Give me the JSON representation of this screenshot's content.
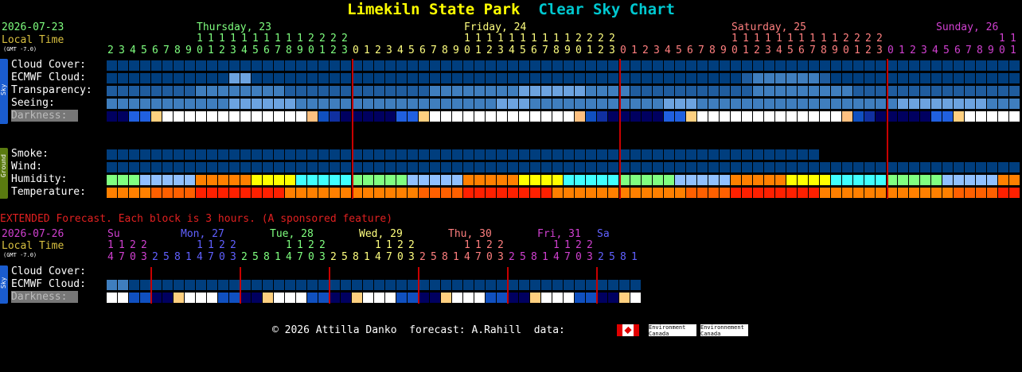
{
  "header": {
    "site_name": "Limekiln State Park",
    "chart_name": "Clear Sky Chart",
    "site_color": "#ffff00",
    "chart_color": "#00c8d0"
  },
  "main": {
    "date": "2026-07-23",
    "local_time_label": "Local Time",
    "gmt_offset": "(GMT -7.0)",
    "days": [
      {
        "label": "Thursday, 23",
        "color": "#7fff7f"
      },
      {
        "label": "Friday, 24",
        "color": "#ffff7f"
      },
      {
        "label": "Saturday, 25",
        "color": "#ff7f7f"
      },
      {
        "label": "Sunday, 26",
        "color": "#d040d0"
      }
    ],
    "hours_tens": [
      "",
      "",
      "",
      "",
      "",
      "",
      "",
      "",
      "1",
      "1",
      "1",
      "1",
      "1",
      "1",
      "1",
      "1",
      "1",
      "1",
      "2",
      "2",
      "2",
      "2",
      "",
      "",
      "",
      "",
      "",
      "",
      "",
      "",
      "",
      "",
      "1",
      "1",
      "1",
      "1",
      "1",
      "1",
      "1",
      "1",
      "1",
      "1",
      "2",
      "2",
      "2",
      "2",
      "",
      "",
      "",
      "",
      "",
      "",
      "",
      "",
      "",
      "",
      "1",
      "1",
      "1",
      "1",
      "1",
      "1",
      "1",
      "1",
      "1",
      "1",
      "2",
      "2",
      "2",
      "2",
      "",
      "",
      "",
      "",
      "",
      "",
      "",
      "",
      "",
      "",
      "1",
      "1"
    ],
    "hours_ones": [
      "2",
      "3",
      "4",
      "5",
      "6",
      "7",
      "8",
      "9",
      "0",
      "1",
      "2",
      "3",
      "4",
      "5",
      "6",
      "7",
      "8",
      "9",
      "0",
      "1",
      "2",
      "3",
      "0",
      "1",
      "2",
      "3",
      "4",
      "5",
      "6",
      "7",
      "8",
      "9",
      "0",
      "1",
      "2",
      "3",
      "4",
      "5",
      "6",
      "7",
      "8",
      "9",
      "0",
      "1",
      "2",
      "3",
      "0",
      "1",
      "2",
      "3",
      "4",
      "5",
      "6",
      "7",
      "8",
      "9",
      "0",
      "1",
      "2",
      "3",
      "4",
      "5",
      "6",
      "7",
      "8",
      "9",
      "0",
      "1",
      "2",
      "3",
      "0",
      "1",
      "2",
      "3",
      "4",
      "5",
      "6",
      "7",
      "8",
      "9",
      "0",
      "1"
    ],
    "sky_tab": "Sky",
    "ground_tab": "Ground",
    "rows": {
      "cloud_cover": "Cloud Cover:",
      "ecmwf_cloud": "ECMWF Cloud:",
      "transparency": "Transparency:",
      "seeing": "Seeing:",
      "darkness": "Darkness:",
      "smoke": "Smoke:",
      "wind": "Wind:",
      "humidity": "Humidity:",
      "temperature": "Temperature:"
    }
  },
  "extended": {
    "heading": "EXTENDED Forecast. Each block is 3 hours. (A sponsored feature)",
    "heading_color": "#e02020",
    "date": "2026-07-26",
    "local_time_label": "Local Time",
    "gmt_offset": "(GMT -7.0)",
    "days": [
      {
        "label": "Su",
        "color": "#d040d0"
      },
      {
        "label": "Mon, 27",
        "color": "#6060ff"
      },
      {
        "label": "Tue, 28",
        "color": "#7fff7f"
      },
      {
        "label": "Wed, 29",
        "color": "#ffff7f"
      },
      {
        "label": "Thu, 30",
        "color": "#ff7f7f"
      },
      {
        "label": "Fri, 31",
        "color": "#d040d0"
      },
      {
        "label": "Sa",
        "color": "#6060ff"
      }
    ],
    "hours_tens": [
      "1",
      "1",
      "2",
      "2",
      "",
      "",
      "",
      "",
      "1",
      "1",
      "2",
      "2",
      "",
      "",
      "",
      "",
      "1",
      "1",
      "2",
      "2",
      "",
      "",
      "",
      "",
      "1",
      "1",
      "2",
      "2",
      "",
      "",
      "",
      "",
      "1",
      "1",
      "2",
      "2",
      "",
      "",
      "",
      "",
      "1",
      "1",
      "2",
      "2",
      "",
      "",
      "",
      "",
      "1"
    ],
    "hours_ones": [
      "4",
      "7",
      "0",
      "3",
      "2",
      "5",
      "8",
      "1",
      "4",
      "7",
      "0",
      "3",
      "2",
      "5",
      "8",
      "1",
      "4",
      "7",
      "0",
      "3",
      "2",
      "5",
      "8",
      "1",
      "4",
      "7",
      "0",
      "3",
      "2",
      "5",
      "8",
      "1",
      "4",
      "7",
      "0",
      "3",
      "2",
      "5",
      "8",
      "1",
      "4",
      "7",
      "0",
      "3",
      "2",
      "5",
      "8",
      "1"
    ],
    "sky_tab": "Sky",
    "rows": {
      "cloud_cover": "Cloud Cover:",
      "ecmwf_cloud": "ECMWF Cloud:",
      "darkness": "Darkness:"
    }
  },
  "footer": {
    "copyright": "© 2026 Attilla Danko  forecast: A.Rahill  data:",
    "logo_text_1": "Environment Canada",
    "logo_text_2": "Environnement Canada"
  },
  "colors": {
    "dark_blue": "#003e7e",
    "mid_blue": "#1f5c9e",
    "light_blue": "#3f7ebe",
    "pale_blue": "#6ca3e0",
    "midnight_line": "#c80000"
  }
}
